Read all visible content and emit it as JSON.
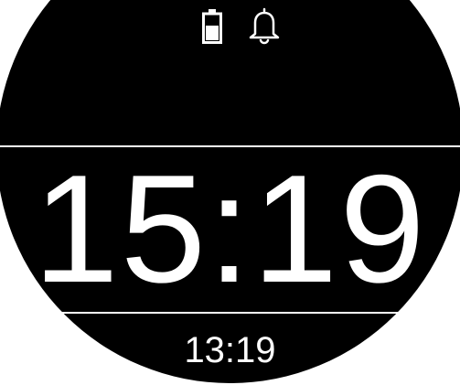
{
  "status_bar": {
    "icons": [
      "battery-icon",
      "bell-icon"
    ]
  },
  "clock": {
    "main_time": "15:19",
    "secondary_time": "13:19"
  },
  "colors": {
    "face_background": "#000000",
    "foreground": "#ffffff",
    "screen_background": "#ffffff"
  }
}
